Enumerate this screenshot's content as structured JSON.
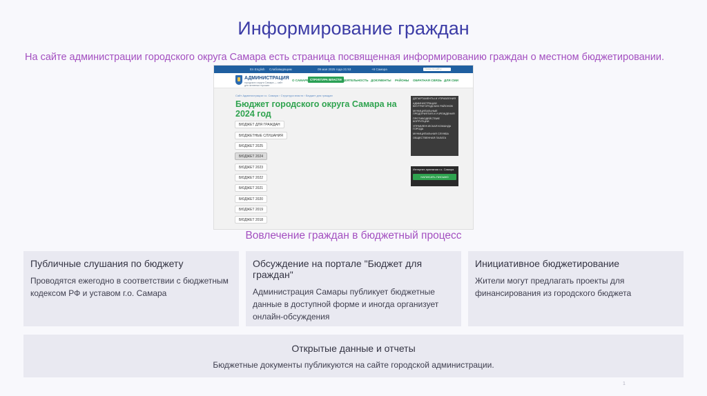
{
  "slide": {
    "title": "Информирование граждан",
    "intro": "На сайте администрации городского округа Самара есть страница посвященная информированию граждан о местном бюджетировании.",
    "subtitle": "Вовлечение граждан в бюджетный процесс",
    "page_number": "1"
  },
  "website": {
    "topbar": {
      "lang": "En English",
      "accessibility": "Слабовидящим",
      "date": "09 мая 2025 года 21:53",
      "temp": "+8 Самара",
      "search_placeholder": "Поиск по сайту"
    },
    "brand": "АДМИНИСТРАЦИЯ",
    "brand_sub": "городского округа Самара — сайт для активных горожан",
    "menu": [
      "О САМАРЕ",
      "СТРУКТУРА ВЛАСТИ",
      "ДЕЯТЕЛЬНОСТЬ",
      "ДОКУМЕНТЫ",
      "РАЙОНЫ",
      "ОБРАТНАЯ СВЯЗЬ",
      "ДЛЯ СМИ"
    ],
    "breadcrumb": "Сайт Администрации г.о. Самара › Структура власти › Бюджет для граждан",
    "heading": "Бюджет городского округа Самара на 2024 год",
    "chips": [
      "БЮДЖЕТ ДЛЯ ГРАЖДАН",
      "БЮДЖЕТНЫЕ СЛУШАНИЯ",
      "БЮДЖЕТ 2025",
      "БЮДЖЕТ 2024",
      "БЮДЖЕТ 2023",
      "БЮДЖЕТ 2022",
      "БЮДЖЕТ 2021",
      "БЮДЖЕТ 2020",
      "БЮДЖЕТ 2019",
      "БЮДЖЕТ 2018"
    ],
    "selected_chip": "БЮДЖЕТ 2024",
    "side_links": [
      "Департаменты и управления",
      "Администрации внутригородских районов",
      "Муниципальные предприятия и учреждения",
      "Противодействие коррупции",
      "Управленческая команда города",
      "Муниципальная служба",
      "Общественная палата"
    ],
    "net_title": "Интернет-приемная г.о. Самара",
    "net_button": "НАПИСАТЬ ПИСЬМО"
  },
  "cards": [
    {
      "title": "Публичные слушания по бюджету",
      "text": "Проводятся ежегодно в соответствии с бюджетным кодексом РФ и уставом г.о. Самара"
    },
    {
      "title": "Обсуждение на портале \"Бюджет для граждан\"",
      "text": "Администрация Самары публикует бюджетные данные в доступной форме и иногда организует онлайн-обсуждения"
    },
    {
      "title": "Инициативное бюджетирование",
      "text": "Жители могут предлагать проекты для финансирования из городского бюджета"
    }
  ],
  "wide_card": {
    "title": "Открытые данные и отчеты",
    "text": "Бюджетные документы публикуются на сайте городской администрации."
  },
  "colors": {
    "title": "#3c3ca6",
    "accent_purple": "#a34fc0",
    "site_green": "#2fa34f",
    "site_blue": "#1f5fa0",
    "card_bg": "#e9e9f1"
  }
}
